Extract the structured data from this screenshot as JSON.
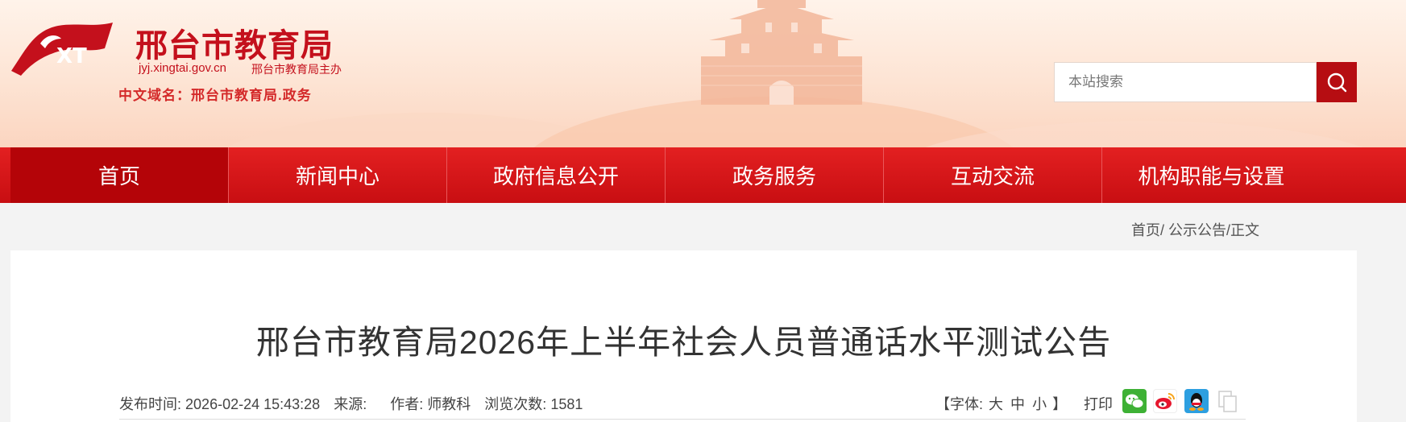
{
  "header": {
    "logo_text": "XT",
    "site_title": "邢台市教育局",
    "domain_en": "jyj.xingtai.gov.cn",
    "sponsor": "邢台市教育局主办",
    "domain_cn": "中文域名：邢台市教育局.政务"
  },
  "search": {
    "placeholder": "本站搜索"
  },
  "nav": {
    "items": [
      "首页",
      "新闻中心",
      "政府信息公开",
      "政务服务",
      "互动交流",
      "机构职能与设置"
    ]
  },
  "breadcrumb": {
    "home": "首页",
    "sep1": "/",
    "section": "公示公告",
    "sep2": "/",
    "current": "正文"
  },
  "article": {
    "title": "邢台市教育局2026年上半年社会人员普通话水平测试公告",
    "published_label": "发布时间:",
    "published": "2026-02-24 15:43:28",
    "source_label": "来源:",
    "author_label": "作者:",
    "author": "师教科",
    "views_label": "浏览次数:",
    "views": "1581"
  },
  "tools": {
    "font_label": "【字体:",
    "font_large": "大",
    "font_medium": "中",
    "font_small": "小",
    "font_close": "】",
    "print": "打印"
  },
  "colors": {
    "brand_red": "#c4101c",
    "nav_red": "#d81b1c",
    "nav_active": "#b40408"
  }
}
